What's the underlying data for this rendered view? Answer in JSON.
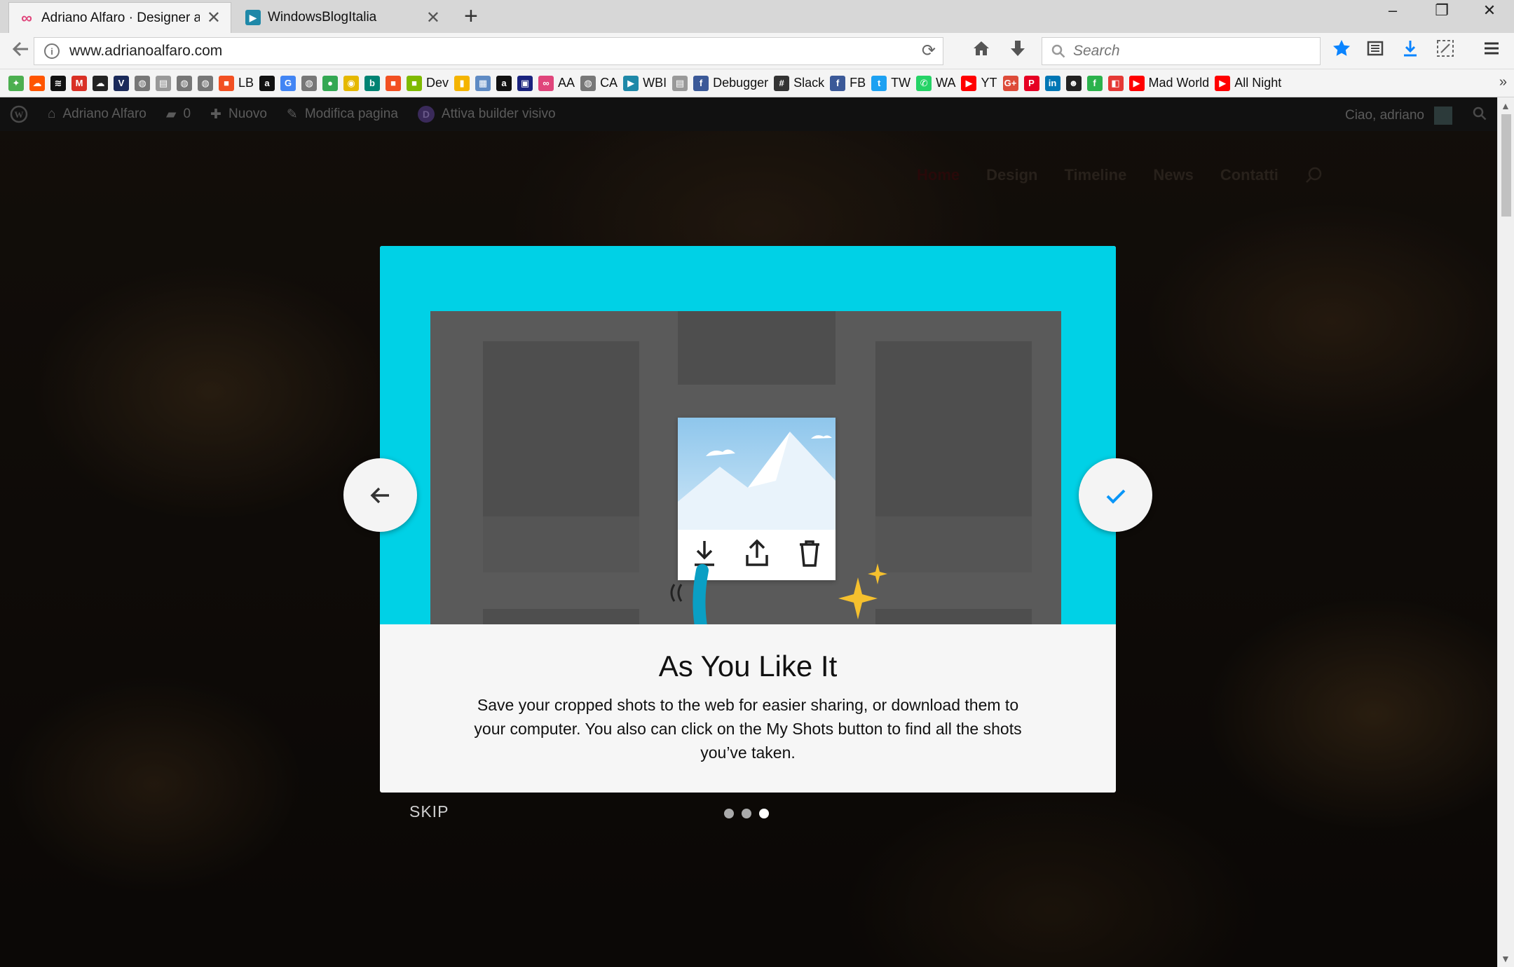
{
  "tabs": [
    {
      "title": "Adriano Alfaro · Designer a S",
      "active": true
    },
    {
      "title": "WindowsBlogItalia",
      "active": false
    }
  ],
  "window_controls": {
    "minimize": "–",
    "restore": "❐",
    "close": "✕"
  },
  "navbar": {
    "url": "www.adrianoalfaro.com",
    "search_placeholder": "Search"
  },
  "bookmarks": [
    {
      "label": "",
      "icon": "bookmark-icon",
      "color": "#4caf50"
    },
    {
      "label": "",
      "icon": "soundcloud-icon",
      "color": "#ff5500"
    },
    {
      "label": "",
      "icon": "spotify-icon",
      "color": "#111111"
    },
    {
      "label": "",
      "icon": "gmail-icon",
      "color": "#d93025"
    },
    {
      "label": "",
      "icon": "cloud-icon",
      "color": "#222222"
    },
    {
      "label": "",
      "icon": "vectr-icon",
      "color": "#1b2a5a"
    },
    {
      "label": "",
      "icon": "globe-icon",
      "color": "#777777"
    },
    {
      "label": "",
      "icon": "page-icon",
      "color": "#999999"
    },
    {
      "label": "",
      "icon": "globe-icon",
      "color": "#777777"
    },
    {
      "label": "",
      "icon": "globe-icon",
      "color": "#777777"
    },
    {
      "label": "LB",
      "icon": "microsoft-icon",
      "color": "#f25022"
    },
    {
      "label": "",
      "icon": "amazon-icon",
      "color": "#111111"
    },
    {
      "label": "",
      "icon": "google-icon",
      "color": "#4285f4"
    },
    {
      "label": "",
      "icon": "globe-icon",
      "color": "#777777"
    },
    {
      "label": "",
      "icon": "chrome-icon",
      "color": "#34a853"
    },
    {
      "label": "",
      "icon": "compass-icon",
      "color": "#e5b800"
    },
    {
      "label": "",
      "icon": "bing-icon",
      "color": "#008373"
    },
    {
      "label": "",
      "icon": "microsoft-icon",
      "color": "#f25022"
    },
    {
      "label": "Dev",
      "icon": "microsoft-icon",
      "color": "#7fba00"
    },
    {
      "label": "",
      "icon": "chart-icon",
      "color": "#f4b400"
    },
    {
      "label": "",
      "icon": "calendar-icon",
      "color": "#5f8bc4"
    },
    {
      "label": "",
      "icon": "amazon-icon",
      "color": "#111111"
    },
    {
      "label": "",
      "icon": "shop-icon",
      "color": "#1a237e"
    },
    {
      "label": "AA",
      "icon": "infinity-icon",
      "color": "#e0457b"
    },
    {
      "label": "CA",
      "icon": "globe-icon",
      "color": "#777777"
    },
    {
      "label": "WBI",
      "icon": "wbi-icon",
      "color": "#1e88a8"
    },
    {
      "label": "",
      "icon": "page-icon",
      "color": "#999999"
    },
    {
      "label": "Debugger",
      "icon": "facebook-icon",
      "color": "#3b5998"
    },
    {
      "label": "Slack",
      "icon": "slack-icon",
      "color": "#333333"
    },
    {
      "label": "FB",
      "icon": "facebook-icon",
      "color": "#3b5998"
    },
    {
      "label": "TW",
      "icon": "twitter-icon",
      "color": "#1da1f2"
    },
    {
      "label": "WA",
      "icon": "whatsapp-icon",
      "color": "#25d366"
    },
    {
      "label": "YT",
      "icon": "youtube-icon",
      "color": "#ff0000"
    },
    {
      "label": "",
      "icon": "googleplus-icon",
      "color": "#dd4b39"
    },
    {
      "label": "",
      "icon": "pinterest-icon",
      "color": "#e60023"
    },
    {
      "label": "",
      "icon": "linkedin-icon",
      "color": "#0077b5"
    },
    {
      "label": "",
      "icon": "people-icon",
      "color": "#222222"
    },
    {
      "label": "",
      "icon": "feedly-icon",
      "color": "#2bb24c"
    },
    {
      "label": "",
      "icon": "app-icon",
      "color": "#e53935"
    },
    {
      "label": "Mad World",
      "icon": "youtube-icon",
      "color": "#ff0000"
    },
    {
      "label": "All Night",
      "icon": "youtube-icon",
      "color": "#ff0000"
    }
  ],
  "wp_admin_bar": {
    "site_name": "Adriano Alfaro",
    "comments_count": "0",
    "new_label": "Nuovo",
    "edit_label": "Modifica pagina",
    "builder_label": "Attiva builder visivo",
    "greeting": "Ciao, adriano"
  },
  "site_nav": [
    "Home",
    "Design",
    "Timeline",
    "News",
    "Contatti"
  ],
  "onboarding": {
    "title": "As You Like It",
    "body": "Save your cropped shots to the web for easier sharing, or download them to your computer. You also can click on the My Shots button to find all the shots you’ve taken.",
    "skip_label": "SKIP",
    "pages": 3,
    "current_page": 3,
    "hero_color": "#00d1e6",
    "accent_color": "#0996f8"
  }
}
